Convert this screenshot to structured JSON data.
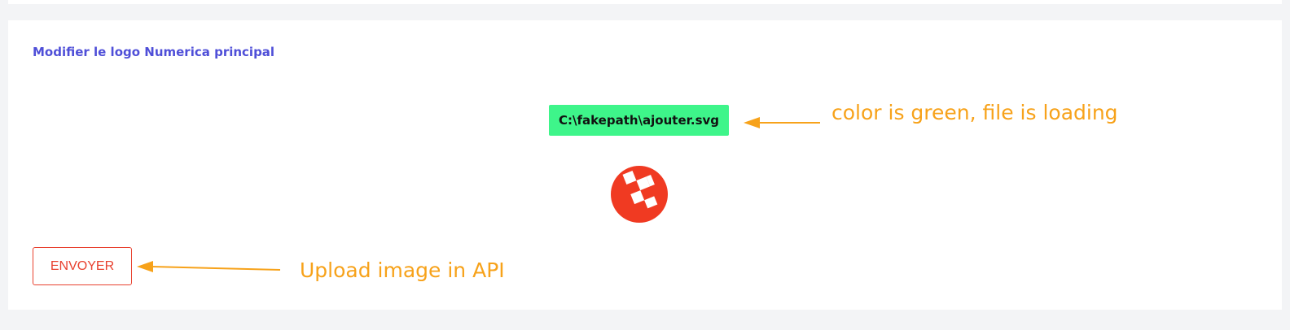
{
  "section": {
    "title": "Modifier le logo Numerica principal"
  },
  "file_input": {
    "value": "C:\\fakepath\\ajouter.svg",
    "color": "#3ef58a"
  },
  "logo": {
    "icon": "numerica-logo-icon",
    "color": "#f03a22"
  },
  "send": {
    "label": "ENVOYER",
    "color": "#e8412f"
  },
  "annotations": {
    "file_note": "color is green, file is loading",
    "send_note": "Upload image in API",
    "color": "#f7a21a"
  }
}
